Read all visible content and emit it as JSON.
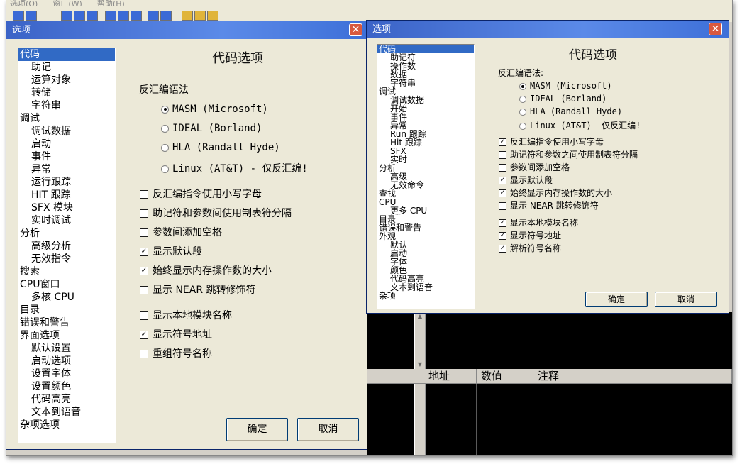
{
  "menu": [
    "选项(O)",
    "窗口(W)",
    "帮助(H)"
  ],
  "columns": [
    "地址",
    "数值",
    "注释"
  ],
  "scroll": {
    "up": "▲",
    "down": "▼"
  },
  "dialog_left": {
    "title": "选项",
    "close": "✕",
    "panel_title": "代码选项",
    "syntax_label": "反汇编语法",
    "tree": [
      {
        "label": "代码",
        "level": 0,
        "selected": true
      },
      {
        "label": "助记",
        "level": 1
      },
      {
        "label": "运算对象",
        "level": 1
      },
      {
        "label": "转储",
        "level": 1
      },
      {
        "label": "字符串",
        "level": 1
      },
      {
        "label": "调试",
        "level": 0
      },
      {
        "label": "调试数据",
        "level": 1
      },
      {
        "label": "启动",
        "level": 1
      },
      {
        "label": "事件",
        "level": 1
      },
      {
        "label": "异常",
        "level": 1
      },
      {
        "label": "运行跟踪",
        "level": 1
      },
      {
        "label": "HIT 跟踪",
        "level": 1
      },
      {
        "label": "SFX 模块",
        "level": 1
      },
      {
        "label": "实时调试",
        "level": 1
      },
      {
        "label": "分析",
        "level": 0
      },
      {
        "label": "高级分析",
        "level": 1
      },
      {
        "label": "无效指令",
        "level": 1
      },
      {
        "label": "搜索",
        "level": 0
      },
      {
        "label": "CPU窗口",
        "level": 0
      },
      {
        "label": "多核 CPU",
        "level": 1
      },
      {
        "label": "目录",
        "level": 0
      },
      {
        "label": "错误和警告",
        "level": 0
      },
      {
        "label": "界面选项",
        "level": 0
      },
      {
        "label": "默认设置",
        "level": 1
      },
      {
        "label": "启动选项",
        "level": 1
      },
      {
        "label": "设置字体",
        "level": 1
      },
      {
        "label": "设置颜色",
        "level": 1
      },
      {
        "label": "代码高亮",
        "level": 1
      },
      {
        "label": "文本到语音",
        "level": 1
      },
      {
        "label": "杂项选项",
        "level": 0
      }
    ],
    "radios": [
      {
        "label": "MASM (Microsoft)",
        "checked": true
      },
      {
        "label": "IDEAL (Borland)",
        "checked": false
      },
      {
        "label": "HLA (Randall Hyde)",
        "checked": false
      },
      {
        "label": "Linux (AT&T) - 仅反汇编!",
        "checked": false
      }
    ],
    "checks": [
      {
        "label": "反汇编指令使用小写字母",
        "checked": false
      },
      {
        "label": "助记符和参数间使用制表符分隔",
        "checked": false
      },
      {
        "label": "参数间添加空格",
        "checked": false
      },
      {
        "label": "显示默认段",
        "checked": true
      },
      {
        "label": "始终显示内存操作数的大小",
        "checked": true
      },
      {
        "label": "显示 NEAR 跳转修饰符",
        "checked": false
      },
      {
        "label": "显示本地模块名称",
        "checked": false
      },
      {
        "label": "显示符号地址",
        "checked": true
      },
      {
        "label": "重组符号名称",
        "checked": false
      }
    ],
    "ok": "确定",
    "cancel": "取消"
  },
  "dialog_right": {
    "title": "选项",
    "close": "✕",
    "panel_title": "代码选项",
    "syntax_label": "反汇编语法:",
    "tree": [
      {
        "label": "代码",
        "level": 0,
        "selected": true
      },
      {
        "label": "助记符",
        "level": 1
      },
      {
        "label": "操作数",
        "level": 1
      },
      {
        "label": "数据",
        "level": 1
      },
      {
        "label": "字符串",
        "level": 1
      },
      {
        "label": "调试",
        "level": 0
      },
      {
        "label": "调试数据",
        "level": 1
      },
      {
        "label": "开始",
        "level": 1
      },
      {
        "label": "事件",
        "level": 1
      },
      {
        "label": "异常",
        "level": 1
      },
      {
        "label": "Run 跟踪",
        "level": 1
      },
      {
        "label": "Hit 跟踪",
        "level": 1
      },
      {
        "label": "SFX",
        "level": 1
      },
      {
        "label": "实时",
        "level": 1
      },
      {
        "label": "分析",
        "level": 0
      },
      {
        "label": "高级",
        "level": 1
      },
      {
        "label": "无效命令",
        "level": 1
      },
      {
        "label": "查找",
        "level": 0
      },
      {
        "label": "CPU",
        "level": 0
      },
      {
        "label": "更多 CPU",
        "level": 1
      },
      {
        "label": "目录",
        "level": 0
      },
      {
        "label": "错误和警告",
        "level": 0
      },
      {
        "label": "外观",
        "level": 0
      },
      {
        "label": "默认",
        "level": 1
      },
      {
        "label": "启动",
        "level": 1
      },
      {
        "label": "字体",
        "level": 1
      },
      {
        "label": "颜色",
        "level": 1
      },
      {
        "label": "代码高亮",
        "level": 1
      },
      {
        "label": "文本到语音",
        "level": 1
      },
      {
        "label": "杂项",
        "level": 0
      }
    ],
    "radios": [
      {
        "label": "MASM (Microsoft)",
        "checked": true
      },
      {
        "label": "IDEAL (Borland)",
        "checked": false
      },
      {
        "label": "HLA (Randall Hyde)",
        "checked": false
      },
      {
        "label": "Linux (AT&T) -仅反汇编!",
        "checked": false
      }
    ],
    "checks": [
      {
        "label": "反汇编指令使用小写字母",
        "checked": true
      },
      {
        "label": "助记符和参数之间使用制表符分隔",
        "checked": false
      },
      {
        "label": "参数间添加空格",
        "checked": false
      },
      {
        "label": "显示默认段",
        "checked": true
      },
      {
        "label": "始终显示内存操作数的大小",
        "checked": true
      },
      {
        "label": "显示 NEAR 跳转修饰符",
        "checked": false
      },
      {
        "label": "显示本地模块名称",
        "checked": true
      },
      {
        "label": "显示符号地址",
        "checked": true
      },
      {
        "label": "解析符号名称",
        "checked": true
      }
    ],
    "ok": "确定",
    "cancel": "取消"
  },
  "colors": {
    "titlebar": "#3b63c7",
    "selection": "#316ac5",
    "dialog_bg": "#ece9d8",
    "close": "#d8593f",
    "workspace": "#000000"
  }
}
